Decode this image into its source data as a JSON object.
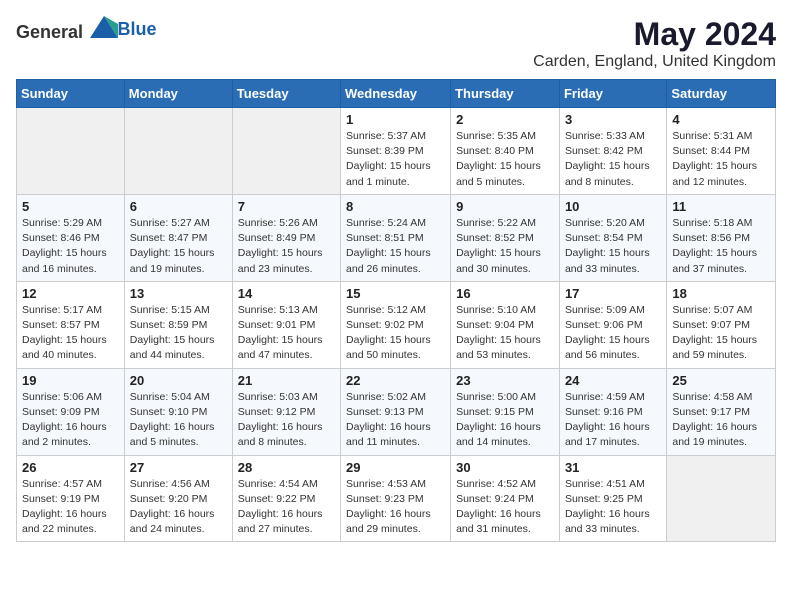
{
  "logo": {
    "text_general": "General",
    "text_blue": "Blue"
  },
  "title": "May 2024",
  "subtitle": "Carden, England, United Kingdom",
  "days_of_week": [
    "Sunday",
    "Monday",
    "Tuesday",
    "Wednesday",
    "Thursday",
    "Friday",
    "Saturday"
  ],
  "weeks": [
    [
      {
        "day": "",
        "info": ""
      },
      {
        "day": "",
        "info": ""
      },
      {
        "day": "",
        "info": ""
      },
      {
        "day": "1",
        "info": "Sunrise: 5:37 AM\nSunset: 8:39 PM\nDaylight: 15 hours\nand 1 minute."
      },
      {
        "day": "2",
        "info": "Sunrise: 5:35 AM\nSunset: 8:40 PM\nDaylight: 15 hours\nand 5 minutes."
      },
      {
        "day": "3",
        "info": "Sunrise: 5:33 AM\nSunset: 8:42 PM\nDaylight: 15 hours\nand 8 minutes."
      },
      {
        "day": "4",
        "info": "Sunrise: 5:31 AM\nSunset: 8:44 PM\nDaylight: 15 hours\nand 12 minutes."
      }
    ],
    [
      {
        "day": "5",
        "info": "Sunrise: 5:29 AM\nSunset: 8:46 PM\nDaylight: 15 hours\nand 16 minutes."
      },
      {
        "day": "6",
        "info": "Sunrise: 5:27 AM\nSunset: 8:47 PM\nDaylight: 15 hours\nand 19 minutes."
      },
      {
        "day": "7",
        "info": "Sunrise: 5:26 AM\nSunset: 8:49 PM\nDaylight: 15 hours\nand 23 minutes."
      },
      {
        "day": "8",
        "info": "Sunrise: 5:24 AM\nSunset: 8:51 PM\nDaylight: 15 hours\nand 26 minutes."
      },
      {
        "day": "9",
        "info": "Sunrise: 5:22 AM\nSunset: 8:52 PM\nDaylight: 15 hours\nand 30 minutes."
      },
      {
        "day": "10",
        "info": "Sunrise: 5:20 AM\nSunset: 8:54 PM\nDaylight: 15 hours\nand 33 minutes."
      },
      {
        "day": "11",
        "info": "Sunrise: 5:18 AM\nSunset: 8:56 PM\nDaylight: 15 hours\nand 37 minutes."
      }
    ],
    [
      {
        "day": "12",
        "info": "Sunrise: 5:17 AM\nSunset: 8:57 PM\nDaylight: 15 hours\nand 40 minutes."
      },
      {
        "day": "13",
        "info": "Sunrise: 5:15 AM\nSunset: 8:59 PM\nDaylight: 15 hours\nand 44 minutes."
      },
      {
        "day": "14",
        "info": "Sunrise: 5:13 AM\nSunset: 9:01 PM\nDaylight: 15 hours\nand 47 minutes."
      },
      {
        "day": "15",
        "info": "Sunrise: 5:12 AM\nSunset: 9:02 PM\nDaylight: 15 hours\nand 50 minutes."
      },
      {
        "day": "16",
        "info": "Sunrise: 5:10 AM\nSunset: 9:04 PM\nDaylight: 15 hours\nand 53 minutes."
      },
      {
        "day": "17",
        "info": "Sunrise: 5:09 AM\nSunset: 9:06 PM\nDaylight: 15 hours\nand 56 minutes."
      },
      {
        "day": "18",
        "info": "Sunrise: 5:07 AM\nSunset: 9:07 PM\nDaylight: 15 hours\nand 59 minutes."
      }
    ],
    [
      {
        "day": "19",
        "info": "Sunrise: 5:06 AM\nSunset: 9:09 PM\nDaylight: 16 hours\nand 2 minutes."
      },
      {
        "day": "20",
        "info": "Sunrise: 5:04 AM\nSunset: 9:10 PM\nDaylight: 16 hours\nand 5 minutes."
      },
      {
        "day": "21",
        "info": "Sunrise: 5:03 AM\nSunset: 9:12 PM\nDaylight: 16 hours\nand 8 minutes."
      },
      {
        "day": "22",
        "info": "Sunrise: 5:02 AM\nSunset: 9:13 PM\nDaylight: 16 hours\nand 11 minutes."
      },
      {
        "day": "23",
        "info": "Sunrise: 5:00 AM\nSunset: 9:15 PM\nDaylight: 16 hours\nand 14 minutes."
      },
      {
        "day": "24",
        "info": "Sunrise: 4:59 AM\nSunset: 9:16 PM\nDaylight: 16 hours\nand 17 minutes."
      },
      {
        "day": "25",
        "info": "Sunrise: 4:58 AM\nSunset: 9:17 PM\nDaylight: 16 hours\nand 19 minutes."
      }
    ],
    [
      {
        "day": "26",
        "info": "Sunrise: 4:57 AM\nSunset: 9:19 PM\nDaylight: 16 hours\nand 22 minutes."
      },
      {
        "day": "27",
        "info": "Sunrise: 4:56 AM\nSunset: 9:20 PM\nDaylight: 16 hours\nand 24 minutes."
      },
      {
        "day": "28",
        "info": "Sunrise: 4:54 AM\nSunset: 9:22 PM\nDaylight: 16 hours\nand 27 minutes."
      },
      {
        "day": "29",
        "info": "Sunrise: 4:53 AM\nSunset: 9:23 PM\nDaylight: 16 hours\nand 29 minutes."
      },
      {
        "day": "30",
        "info": "Sunrise: 4:52 AM\nSunset: 9:24 PM\nDaylight: 16 hours\nand 31 minutes."
      },
      {
        "day": "31",
        "info": "Sunrise: 4:51 AM\nSunset: 9:25 PM\nDaylight: 16 hours\nand 33 minutes."
      },
      {
        "day": "",
        "info": ""
      }
    ]
  ]
}
